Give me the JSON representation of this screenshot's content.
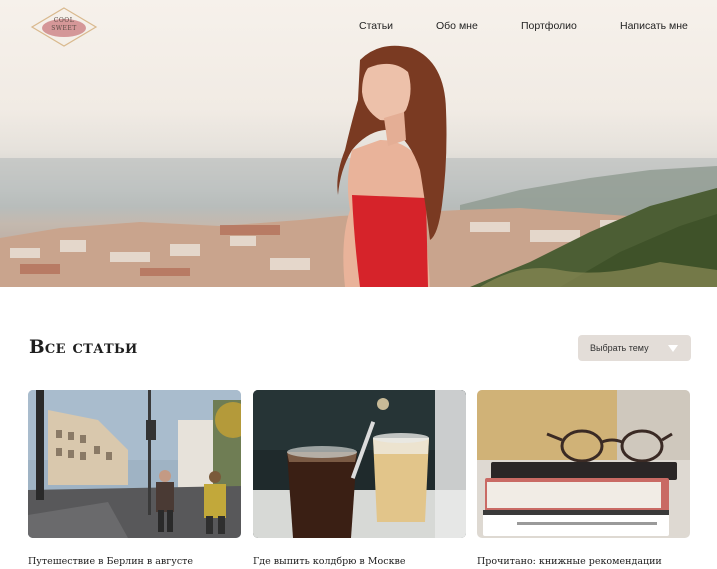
{
  "logo": {
    "text_line1": "COOL",
    "text_line2": "SWEET"
  },
  "nav": {
    "items": [
      {
        "label": "Статьи"
      },
      {
        "label": "Обо мне"
      },
      {
        "label": "Портфолио"
      },
      {
        "label": "Написать мне"
      }
    ]
  },
  "section": {
    "title": "Все статьи",
    "topic_select": {
      "label": "Выбрать тему"
    }
  },
  "articles": [
    {
      "title": "Путешествие в Берлин в августе"
    },
    {
      "title": "Где выпить колдбрю в Москве"
    },
    {
      "title": "Прочитано: книжные рекомендации"
    }
  ],
  "colors": {
    "accent_select_bg": "#e3ddd8",
    "text_dark": "#1e1e1e",
    "dress_red": "#d6232a"
  }
}
